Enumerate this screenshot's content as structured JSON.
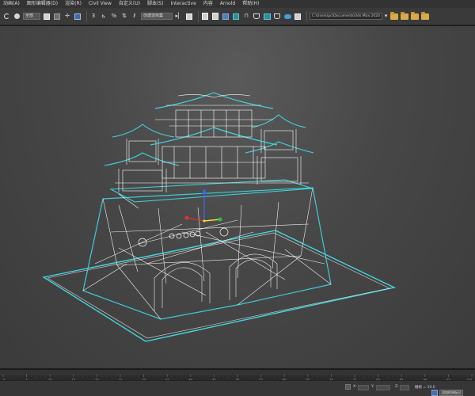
{
  "menubar": {
    "items": [
      "动画(A)",
      "图形编辑器(D)",
      "渲染(R)",
      "Civil View",
      "自定义(U)",
      "脚本(S)",
      "Interactive",
      "内容",
      "Arnold",
      "帮助(H)"
    ]
  },
  "toolbar": {
    "filter_select": "全部",
    "selection_set": "创建选择集",
    "snap_angle_label": "3",
    "percent_snap_label": "%",
    "path": "C:\\Users\\pc\\Documents\\3ds Max 2020"
  },
  "viewport": {
    "wire_color": "#ffffff",
    "highlight_color": "#3fd6e0",
    "background": "#474747"
  },
  "timeline": {
    "ticks": [
      "0",
      "5",
      "10",
      "15",
      "20",
      "25",
      "30",
      "35",
      "40",
      "45",
      "50",
      "55",
      "60",
      "65",
      "70",
      "75",
      "80",
      "85",
      "90",
      "95",
      "100"
    ]
  },
  "statusbar": {
    "x_label": "X:",
    "y_label": "Y:",
    "z_label": "Z:",
    "grid_label": "栅格 = 10.0",
    "add_time_tag": "添加时间标记"
  }
}
